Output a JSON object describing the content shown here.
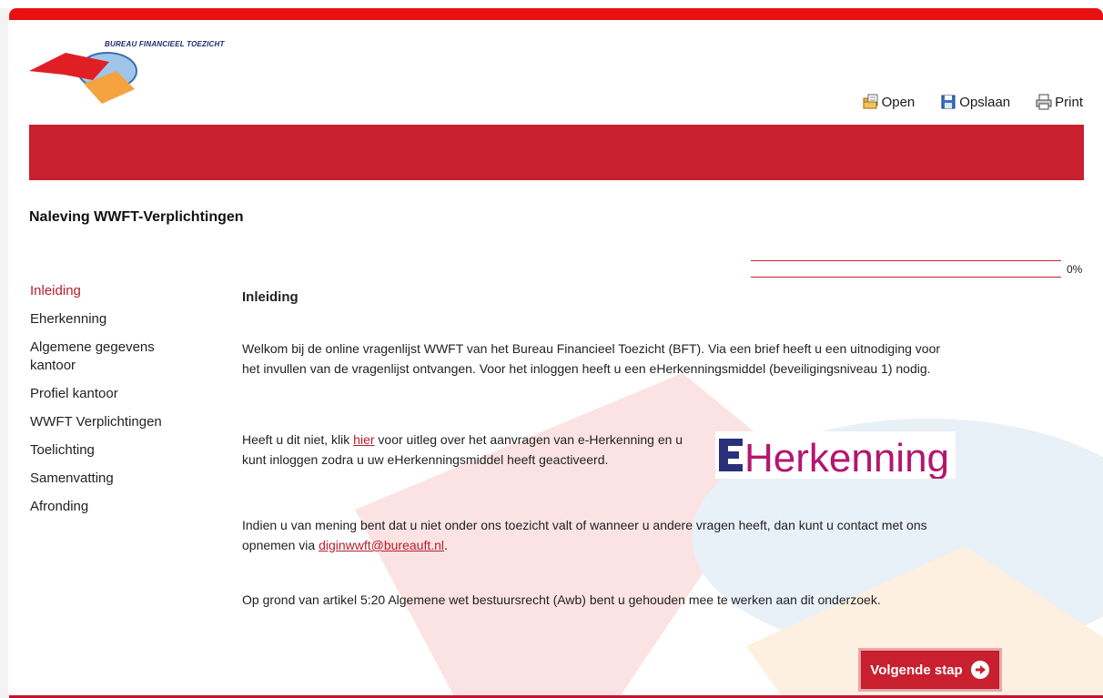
{
  "brand": {
    "name": "BUREAU FINANCIEEL TOEZICHT",
    "accent_color": "#c8202f",
    "top_bar_color": "#e81010"
  },
  "toolbar": {
    "open_label": "Open",
    "save_label": "Opslaan",
    "print_label": "Print"
  },
  "page": {
    "title": "Naleving WWFT-Verplichtingen"
  },
  "progress": {
    "percent": 0,
    "label": "0%"
  },
  "sidebar": {
    "items": [
      {
        "label": "Inleiding",
        "active": true
      },
      {
        "label": "Eherkenning",
        "active": false
      },
      {
        "label": "Algemene gegevens kantoor",
        "active": false
      },
      {
        "label": "Profiel kantoor",
        "active": false
      },
      {
        "label": "WWFT Verplichtingen",
        "active": false
      },
      {
        "label": "Toelichting",
        "active": false
      },
      {
        "label": "Samenvatting",
        "active": false
      },
      {
        "label": "Afronding",
        "active": false
      }
    ]
  },
  "content": {
    "heading": "Inleiding",
    "para1": "Welkom bij de online vragenlijst WWFT van het Bureau Financieel Toezicht (BFT). Via een brief heeft u een uitnodiging voor het invullen van de vragenlijst ontvangen. Voor het inloggen heeft u een eHerkenningsmiddel (beveiligingsniveau 1) nodig.",
    "para2_before": "Heeft u dit niet, klik ",
    "para2_link": "hier",
    "para2_after": " voor uitleg over het aanvragen van e-Herkenning en u kunt inloggen zodra u uw eHerkenningsmiddel heeft geactiveerd.",
    "para3_before": "Indien u van mening bent dat u niet onder ons toezicht valt of wanneer u andere vragen heeft, dan kunt u contact met ons opnemen via ",
    "para3_link": "diginwwft@bureauft.nl",
    "para3_after": ".",
    "para4": "Op grond van artikel 5:20 Algemene wet bestuursrecht (Awb) bent u gehouden mee te werken aan dit onderzoek.",
    "eherkenning_logo": {
      "prefix": "E",
      "text": "Herkenning",
      "color": "#b5156f",
      "prefix_color": "#2a2f7a"
    }
  },
  "actions": {
    "next_label": "Volgende stap"
  },
  "icons": {
    "open": "folder-open-icon",
    "save": "floppy-disk-icon",
    "print": "printer-icon",
    "next": "arrow-circle-right-icon"
  }
}
